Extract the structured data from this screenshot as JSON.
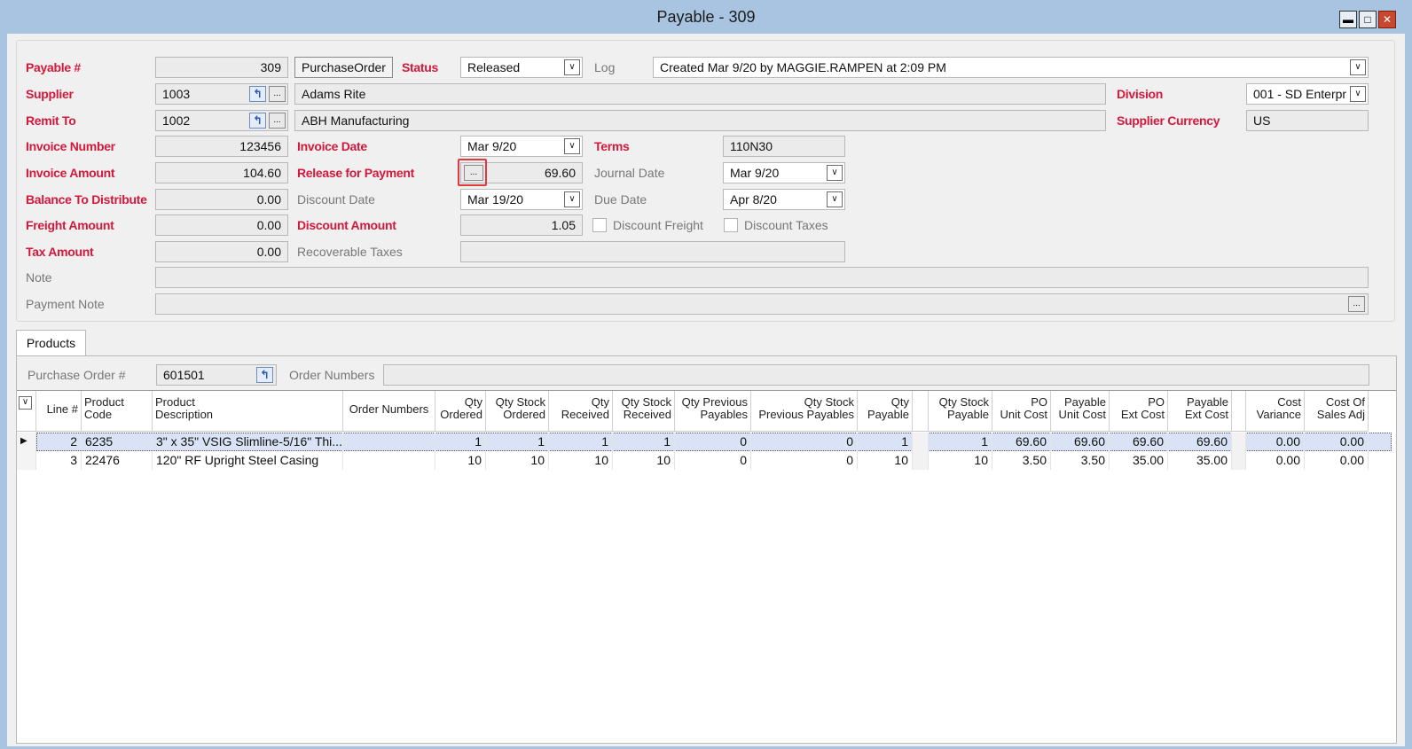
{
  "window": {
    "title": "Payable - 309",
    "minimize_glyph": "▬",
    "maximize_glyph": "□",
    "close_glyph": "✕"
  },
  "header": {
    "payable_label": "Payable #",
    "payable_value": "309",
    "source_button": "PurchaseOrder",
    "status_label": "Status",
    "status_value": "Released",
    "log_label": "Log",
    "log_value": "Created Mar 9/20 by MAGGIE.RAMPEN at 2:09 PM",
    "supplier_label": "Supplier",
    "supplier_code": "1003",
    "supplier_name": "Adams Rite",
    "division_label": "Division",
    "division_value": "001 - SD Enterpr",
    "remit_label": "Remit To",
    "remit_code": "1002",
    "remit_name": "ABH Manufacturing",
    "currency_label": "Supplier Currency",
    "currency_value": "US",
    "invoice_number_label": "Invoice Number",
    "invoice_number_value": "123456",
    "invoice_date_label": "Invoice Date",
    "invoice_date_value": "Mar 9/20",
    "terms_label": "Terms",
    "terms_value": "110N30",
    "invoice_amount_label": "Invoice Amount",
    "invoice_amount_value": "104.60",
    "release_label": "Release for Payment",
    "release_value": "69.60",
    "journal_date_label": "Journal Date",
    "journal_date_value": "Mar 9/20",
    "balance_label": "Balance To Distribute",
    "balance_value": "0.00",
    "discount_date_label": "Discount Date",
    "discount_date_value": "Mar 19/20",
    "due_date_label": "Due Date",
    "due_date_value": "Apr 8/20",
    "freight_label": "Freight Amount",
    "freight_value": "0.00",
    "discount_amount_label": "Discount Amount",
    "discount_amount_value": "1.05",
    "discount_freight_label": "Discount Freight",
    "discount_taxes_label": "Discount Taxes",
    "tax_label": "Tax Amount",
    "tax_value": "0.00",
    "recoverable_label": "Recoverable Taxes",
    "note_label": "Note",
    "payment_note_label": "Payment Note",
    "ellipsis": "...",
    "dropdown_glyph": "∨",
    "link_glyph": "↰"
  },
  "products_tab": {
    "tab_label": "Products",
    "po_label": "Purchase Order #",
    "po_value": "601501",
    "order_numbers_label": "Order Numbers"
  },
  "grid": {
    "columns": [
      "Line #",
      "Product Code",
      "Product Description",
      "Order Numbers",
      "Qty Ordered",
      "Qty Stock Ordered",
      "Qty Received",
      "Qty Stock Received",
      "Qty Previous Payables",
      "Qty Stock Previous Payables",
      "Qty Payable",
      "Qty Stock Payable",
      "PO Unit Cost",
      "Payable Unit Cost",
      "PO Ext Cost",
      "Payable Ext Cost",
      "Cost Variance",
      "Cost Of Sales Adj"
    ],
    "rows": [
      [
        "2",
        "6235",
        "3\" x 35\" VSIG Slimline-5/16\" Thi...",
        "",
        "1",
        "1",
        "1",
        "1",
        "0",
        "0",
        "1",
        "1",
        "69.60",
        "69.60",
        "69.60",
        "69.60",
        "0.00",
        "0.00"
      ],
      [
        "3",
        "22476",
        "120\" RF Upright Steel Casing",
        "",
        "10",
        "10",
        "10",
        "10",
        "0",
        "0",
        "10",
        "10",
        "3.50",
        "3.50",
        "35.00",
        "35.00",
        "0.00",
        "0.00"
      ]
    ],
    "row_indicator": "▶"
  }
}
